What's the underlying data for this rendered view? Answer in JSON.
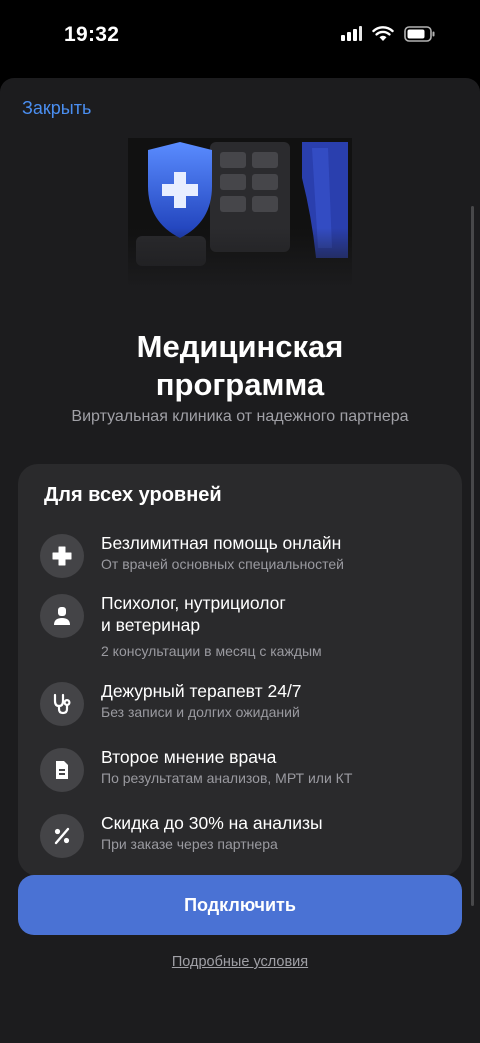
{
  "status_bar": {
    "time": "19:32"
  },
  "header": {
    "close_label": "Закрыть"
  },
  "hero": {
    "title_line1": "Медицинская",
    "title_line2": "программа",
    "subtitle": "Виртуальная клиника от надежного партнера"
  },
  "card": {
    "title": "Для всех уровней",
    "features": [
      {
        "icon": "plus-icon",
        "title": "Безлимитная помощь онлайн",
        "subtitle": "От врачей основных специальностей"
      },
      {
        "icon": "person-icon",
        "title_line1": "Психолог, нутрициолог",
        "title_line2": "и ветеринар",
        "subtitle": "2 консультации в месяц с каждым"
      },
      {
        "icon": "stethoscope-icon",
        "title": "Дежурный терапевт 24/7",
        "subtitle": "Без записи и долгих ожиданий"
      },
      {
        "icon": "document-icon",
        "title": "Второе мнение врача",
        "subtitle": "По результатам анализов, МРТ или КТ"
      },
      {
        "icon": "percent-icon",
        "title": "Скидка до 30% на анализы",
        "subtitle": "При заказе через партнера"
      }
    ]
  },
  "actions": {
    "connect_label": "Подключить",
    "terms_label": "Подробные условия"
  },
  "colors": {
    "accent": "#4a72d4",
    "link": "#4a8ef0",
    "sheet": "#1c1c1e",
    "card": "#2a2a2c"
  }
}
